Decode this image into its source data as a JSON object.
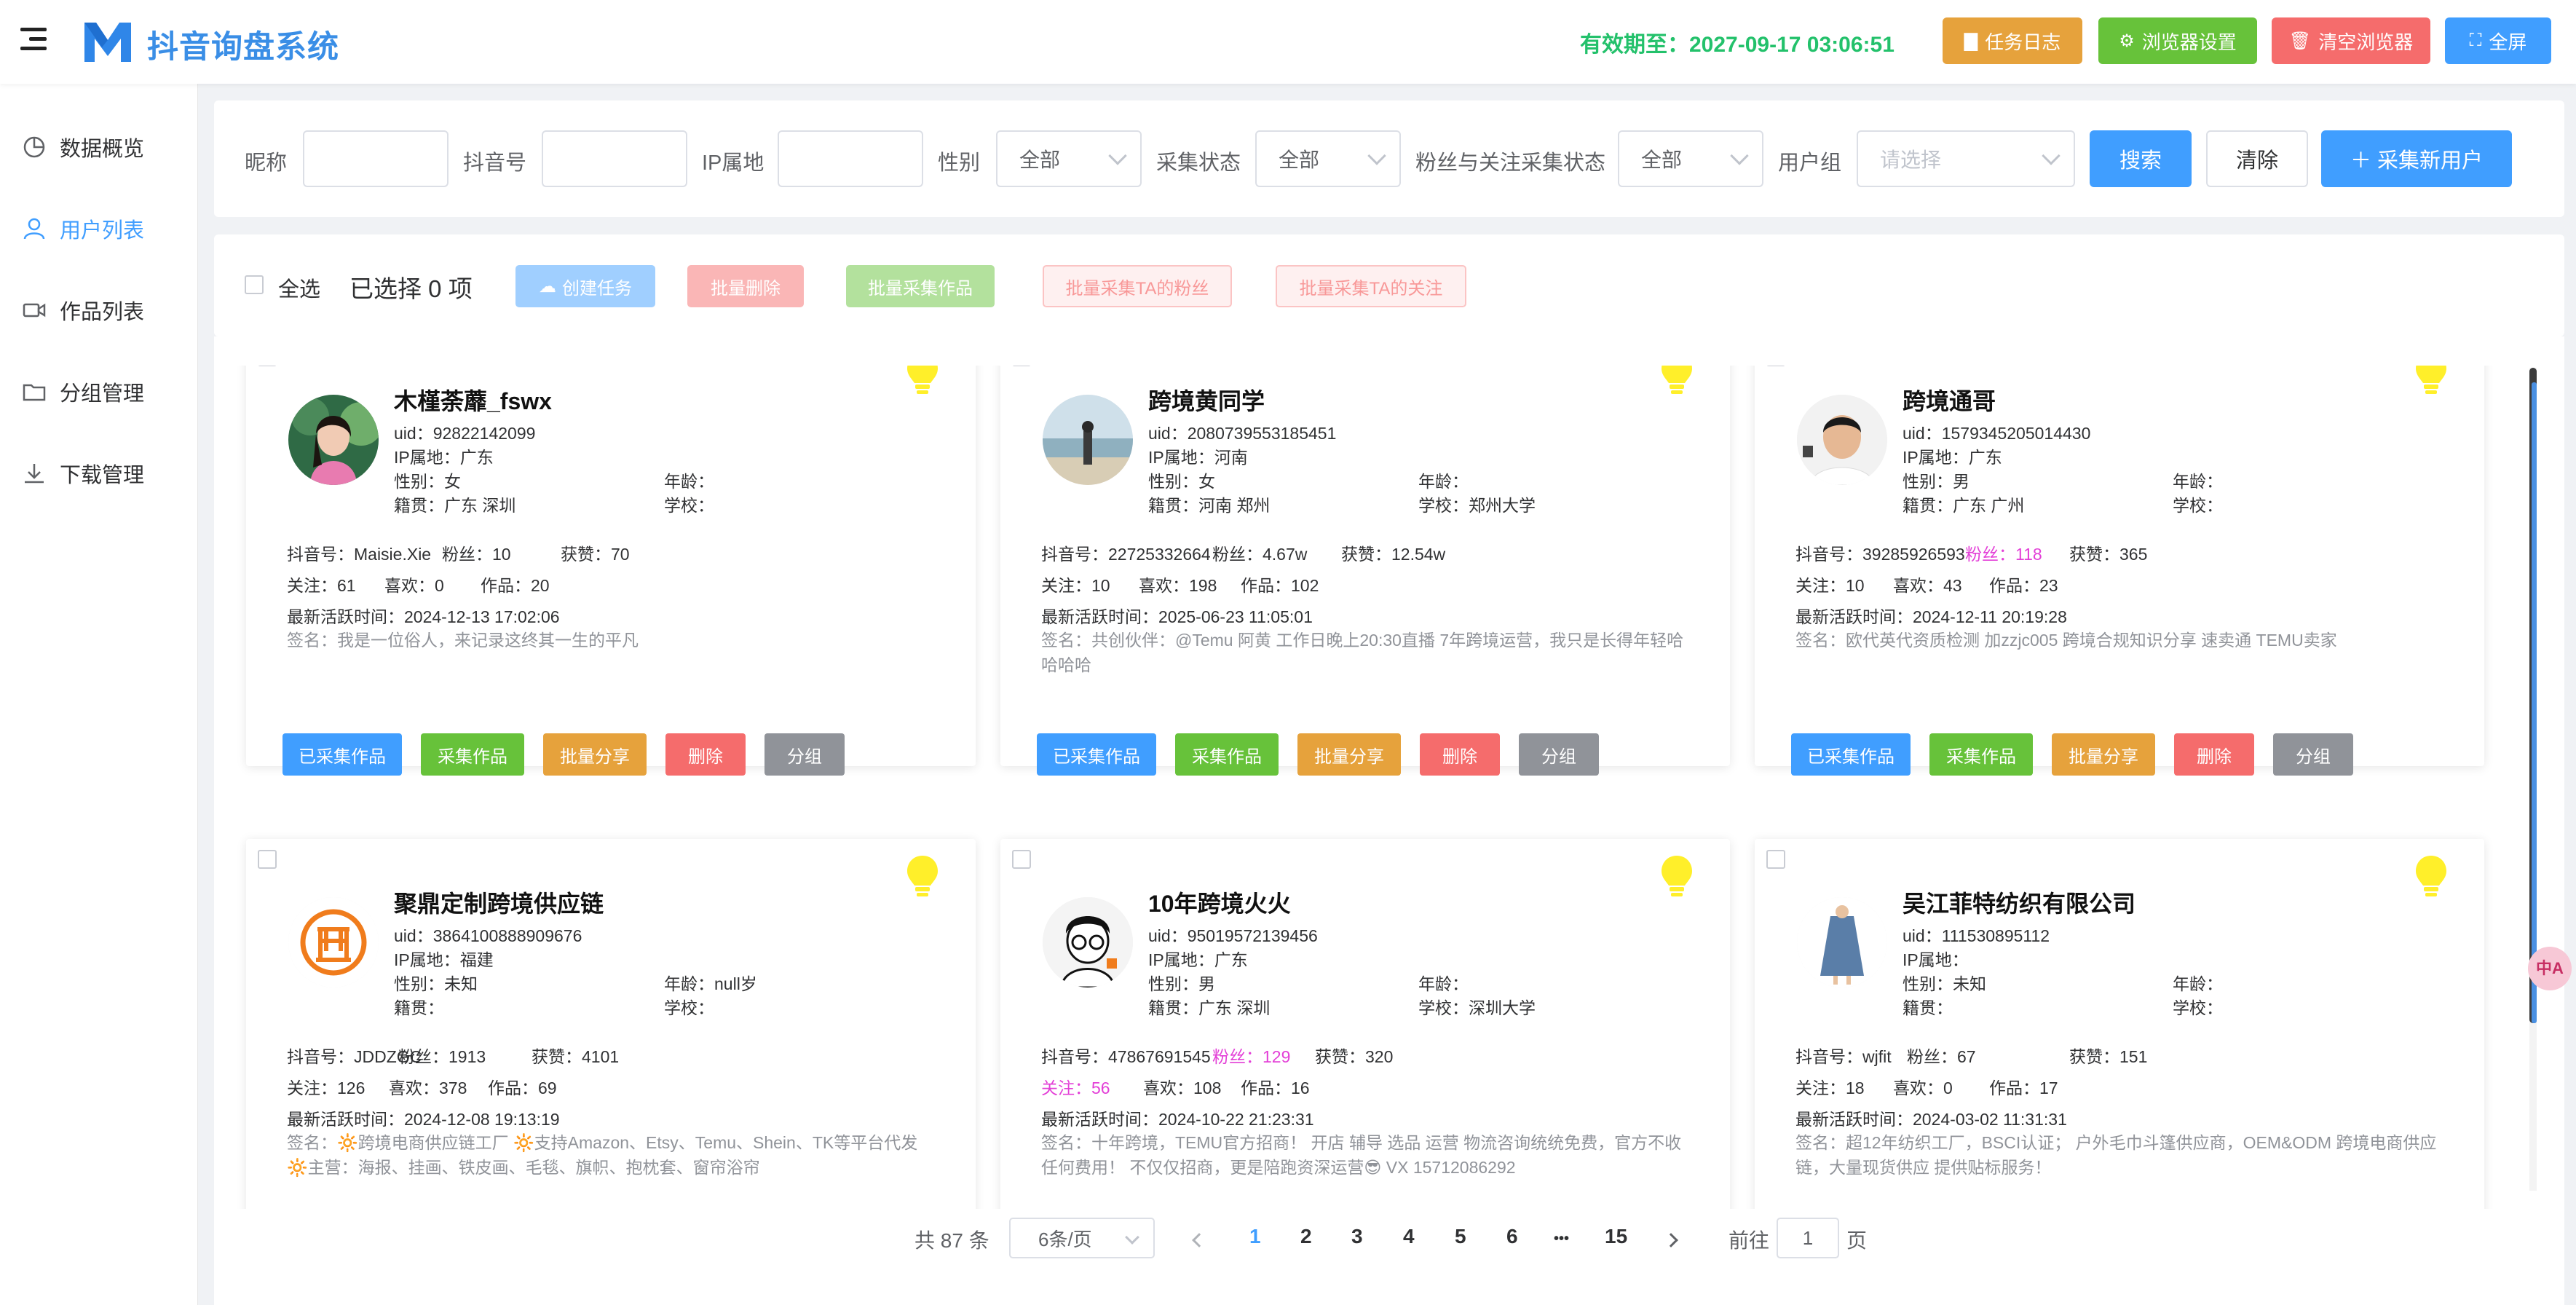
{
  "header": {
    "title": "抖音询盘系统",
    "expire_text": "有效期至：2027-09-17 03:06:51",
    "buttons": [
      {
        "label": "任务日志",
        "icon": "doc-icon",
        "color": "#e6a23c"
      },
      {
        "label": "浏览器设置",
        "icon": "gear-icon",
        "color": "#67c23a"
      },
      {
        "label": "清空浏览器",
        "icon": "trash-icon",
        "color": "#f56c6c"
      },
      {
        "label": "全屏",
        "icon": "fullscreen-icon",
        "color": "#409eff"
      }
    ]
  },
  "sidebar": {
    "items": [
      {
        "label": "数据概览",
        "icon": "pie-chart-icon"
      },
      {
        "label": "用户列表",
        "icon": "user-icon",
        "active": true
      },
      {
        "label": "作品列表",
        "icon": "video-icon"
      },
      {
        "label": "分组管理",
        "icon": "folder-icon"
      },
      {
        "label": "下载管理",
        "icon": "download-icon"
      }
    ]
  },
  "filters": {
    "nickname_label": "昵称",
    "douyin_label": "抖音号",
    "ip_label": "IP属地",
    "gender_label": "性别",
    "gender_value": "全部",
    "collect_label": "采集状态",
    "collect_value": "全部",
    "fans_label": "粉丝与关注采集状态",
    "fans_value": "全部",
    "group_label": "用户组",
    "group_placeholder": "请选择",
    "search_label": "搜索",
    "clear_label": "清除",
    "new_label": "＋ 采集新用户"
  },
  "actions": {
    "select_all": "全选",
    "selected_text": "已选择 0 项",
    "create_task": "创建任务",
    "batch_delete": "批量删除",
    "batch_collect": "批量采集作品",
    "batch_fans": "批量采集TA的粉丝",
    "batch_follow": "批量采集TA的关注"
  },
  "card_buttons": {
    "collected": "已采集作品",
    "collect": "采集作品",
    "share": "批量分享",
    "delete": "删除",
    "group": "分组"
  },
  "cards": [
    {
      "name": "木槿荼蘼_fswx",
      "uid": "uid：92822142099",
      "ip": "IP属地：广东",
      "gender": "性别：女",
      "age": "年龄：",
      "native": "籍贯：广东 深圳",
      "school": "学校：",
      "douyin": "抖音号：Maisie.Xie",
      "fans": "粉丝：10",
      "likes_got": "获赞：70",
      "follow": "关注：61",
      "likes": "喜欢：0",
      "works": "作品：20",
      "active": "最新活跃时间：2024-12-13 17:02:06",
      "sign": "签名：我是一位俗人，来记录这终其一生的平凡",
      "avatar": "woman-photo-avatar"
    },
    {
      "name": "跨境黄同学",
      "uid": "uid：2080739553185451",
      "ip": "IP属地：河南",
      "gender": "性别：女",
      "age": "年龄：",
      "native": "籍贯：河南 郑州",
      "school": "学校：郑州大学",
      "douyin": "抖音号：22725332664",
      "fans": "粉丝：4.67w",
      "likes_got": "获赞：12.54w",
      "follow": "关注：10",
      "likes": "喜欢：198",
      "works": "作品：102",
      "active": "最新活跃时间：2025-06-23 11:05:01",
      "sign": "签名：共创伙伴：@Temu 阿黄 工作日晚上20:30直播 7年跨境运营，我只是长得年轻哈哈哈哈",
      "avatar": "beach-photo-avatar"
    },
    {
      "name": "跨境通哥",
      "uid": "uid：1579345205014430",
      "ip": "IP属地：广东",
      "gender": "性别：男",
      "age": "年龄：",
      "native": "籍贯：广东 广州",
      "school": "学校：",
      "douyin": "抖音号：39285926593",
      "fans": "粉丝：118",
      "likes_got": "获赞：365",
      "follow": "关注：10",
      "likes": "喜欢：43",
      "works": "作品：23",
      "active": "最新活跃时间：2024-12-11 20:19:28",
      "sign": "签名：欧代英代资质检测 加zzjc005 跨境合规知识分享 速卖通 TEMU卖家",
      "avatar": "man-photo-avatar"
    },
    {
      "name": "聚鼎定制跨境供应链",
      "uid": "uid：3864100888909676",
      "ip": "IP属地：福建",
      "gender": "性别：未知",
      "age": "年龄：null岁",
      "native": "籍贯：",
      "school": "学校：",
      "douyin": "抖音号：JDDZGC",
      "fans": "粉丝：1913",
      "likes_got": "获赞：4101",
      "follow": "关注：126",
      "likes": "喜欢：378",
      "works": "作品：69",
      "active": "最新活跃时间：2024-12-08 19:13:19",
      "sign": "签名：🔆跨境电商供应链工厂 🔆支持Amazon、Etsy、Temu、Shein、TK等平台代发 🔆主营：海报、挂画、铁皮画、毛毯、旗帜、抱枕套、窗帘浴帘",
      "avatar": "ding-logo-avatar"
    },
    {
      "name": "10年跨境火火",
      "uid": "uid：95019572139456",
      "ip": "IP属地：广东",
      "gender": "性别：男",
      "age": "年龄：",
      "native": "籍贯：广东 深圳",
      "school": "学校：深圳大学",
      "douyin": "抖音号：47867691545",
      "fans": "粉丝：129",
      "likes_got": "获赞：320",
      "follow": "关注：56",
      "likes": "喜欢：108",
      "works": "作品：16",
      "active": "最新活跃时间：2024-10-22 21:23:31",
      "sign": "签名：十年跨境，TEMU官方招商！ 开店 辅导 选品 运营 物流咨询统统免费，官方不收任何费用！ 不仅仅招商，更是陪跑资深运营😎 VX 15712086292",
      "avatar": "cartoon-glasses-avatar"
    },
    {
      "name": "吴江菲特纺织有限公司",
      "uid": "uid：111530895112",
      "ip": "IP属地：",
      "gender": "性别：未知",
      "age": "年龄：",
      "native": "籍贯：",
      "school": "学校：",
      "douyin": "抖音号：wjfit",
      "fans": "粉丝：67",
      "likes_got": "获赞：151",
      "follow": "关注：18",
      "likes": "喜欢：0",
      "works": "作品：17",
      "active": "最新活跃时间：2024-03-02 11:31:31",
      "sign": "签名：超12年纺织工厂，BSCI认证； 户外毛巾斗篷供应商，OEM&ODM 跨境电商供应链，大量现货供应 提供贴标服务！",
      "avatar": "dress-product-avatar"
    }
  ],
  "pagination": {
    "total": "共 87 条",
    "page_size": "6条/页",
    "pages": [
      "1",
      "2",
      "3",
      "4",
      "5",
      "6",
      "•••",
      "15"
    ],
    "goto_label": "前往",
    "goto_value": "1",
    "page_unit": "页"
  },
  "fab_label": "中A",
  "colors": {
    "primary": "#409eff",
    "success": "#67c23a",
    "warning": "#e6a23c",
    "danger": "#f56c6c",
    "info": "#909399",
    "highlight": "#e33fd7"
  }
}
